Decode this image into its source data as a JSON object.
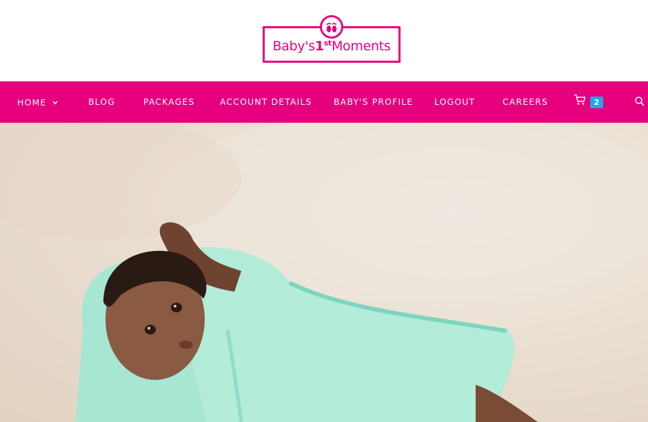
{
  "brand": {
    "logo_prefix": "Baby's",
    "logo_number": "1",
    "logo_superscript": "st",
    "logo_suffix": "Moments",
    "primary_color": "#e6007e",
    "badge_color": "#22a7e0"
  },
  "nav": {
    "items": [
      {
        "label": "HOME",
        "has_dropdown": true
      },
      {
        "label": "BLOG"
      },
      {
        "label": "PACKAGES"
      },
      {
        "label": "ACCOUNT DETAILS"
      },
      {
        "label": "BABY'S PROFILE"
      },
      {
        "label": "LOGOUT"
      },
      {
        "label": "CAREERS"
      }
    ],
    "cart_count": "2",
    "cart_icon": "shopping-cart-icon",
    "search_icon": "search-icon"
  },
  "hero": {
    "image_subject": "baby lying on carpet wrapped in mint green blanket"
  }
}
